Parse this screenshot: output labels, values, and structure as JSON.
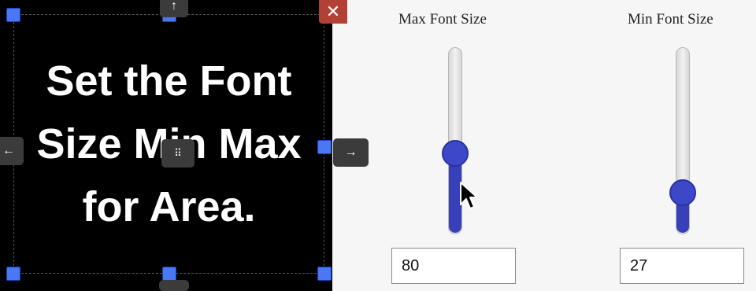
{
  "canvas": {
    "text": "Set the Font Size Min Max for Area.",
    "close_glyph": "✕",
    "move_glyph": "⠿",
    "arrow_up": "↑",
    "arrow_left": "←",
    "arrow_right": "→"
  },
  "controls": {
    "max": {
      "label": "Max Font Size",
      "value": "80",
      "slider_fraction": 0.33
    },
    "min": {
      "label": "Min Font Size",
      "value": "27",
      "slider_fraction": 0.12
    }
  },
  "colors": {
    "accent": "#3d48c8",
    "handle": "#4a78f5",
    "close": "#b34035"
  }
}
